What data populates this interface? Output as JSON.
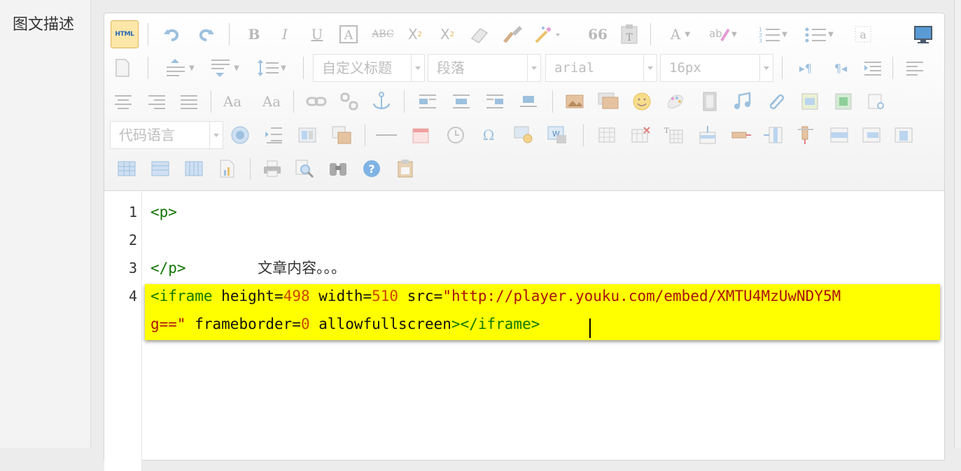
{
  "field_label": "图文描述",
  "toolbar": {
    "html_button": "HTML",
    "custom_title_placeholder": "自定义标题",
    "paragraph_value": "段落",
    "font_family_value": "arial",
    "font_size_value": "16px",
    "code_language_value": "代码语言",
    "icons": [
      "undo-icon",
      "redo-icon",
      "bold-icon",
      "italic-icon",
      "underline-icon",
      "font-border-icon",
      "strikethrough-icon",
      "superscript-icon",
      "subscript-icon",
      "eraser-icon",
      "format-match-icon",
      "autotypeset-icon",
      "blockquote-icon",
      "paste-plain-icon",
      "font-color-icon",
      "back-color-icon",
      "ordered-list-icon",
      "unordered-list-icon",
      "select-all-icon",
      "preview-icon"
    ],
    "colors": {
      "html_button_bg": "#fde7a8",
      "icon_gray": "#b9b9b9"
    }
  },
  "editor": {
    "line_numbers": [
      "1",
      "2",
      "3",
      "4"
    ],
    "line1": "<p>",
    "line2": "文章内容。。。",
    "line3": "</p>",
    "line4": {
      "open_tag": "<iframe",
      "height_attr": "height=",
      "height_val": "498",
      "width_attr": "width=",
      "width_val": "510",
      "src_attr": "src=",
      "src_val_part1": "\"http://player.youku.com/embed/XMTU4MzUwNDY5M",
      "src_val_part2": "g==\"",
      "frameborder_attr": "frameborder=",
      "frameborder_val": "0",
      "allowfullscreen_attr": "allowfullscreen",
      "close_tags": "></iframe>"
    },
    "highlight_color": "#ffff00"
  }
}
